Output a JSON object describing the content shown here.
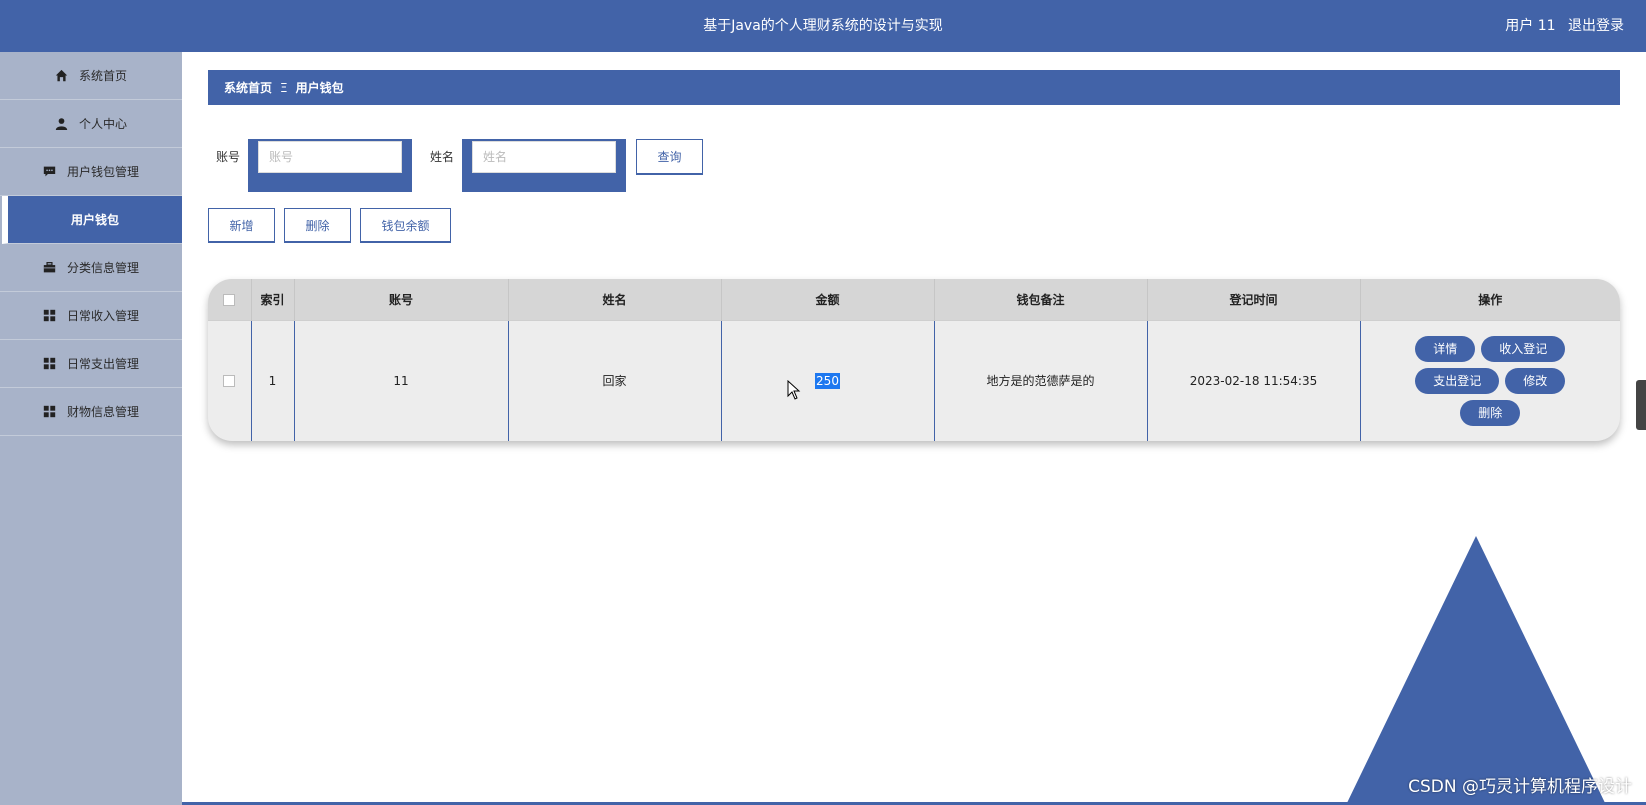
{
  "header": {
    "title": "基于Java的个人理财系统的设计与实现",
    "user_label": "用户 11",
    "logout_label": "退出登录"
  },
  "sidebar": {
    "items": [
      {
        "label": "系统首页",
        "icon": "home-icon"
      },
      {
        "label": "个人中心",
        "icon": "person-icon"
      },
      {
        "label": "用户钱包管理",
        "icon": "chat-icon"
      },
      {
        "label": "用户钱包",
        "icon": "",
        "active": true
      },
      {
        "label": "分类信息管理",
        "icon": "briefcase-icon"
      },
      {
        "label": "日常收入管理",
        "icon": "grid-icon"
      },
      {
        "label": "日常支出管理",
        "icon": "grid-icon"
      },
      {
        "label": "财物信息管理",
        "icon": "grid-icon"
      }
    ]
  },
  "breadcrumb": {
    "home": "系统首页",
    "separator": "Ξ",
    "current": "用户钱包"
  },
  "search": {
    "account_label": "账号",
    "account_placeholder": "账号",
    "account_value": "",
    "name_label": "姓名",
    "name_placeholder": "姓名",
    "name_value": "",
    "query_label": "查询"
  },
  "actions": {
    "add_label": "新增",
    "delete_label": "删除",
    "balance_label": "钱包余额"
  },
  "table": {
    "columns": [
      "索引",
      "账号",
      "姓名",
      "金额",
      "钱包备注",
      "登记时间",
      "操作"
    ],
    "rows": [
      {
        "index": "1",
        "account": "11",
        "name": "回家",
        "amount": "250",
        "note": "地方是的范德萨是的",
        "time": "2023-02-18 11:54:35"
      }
    ],
    "row_actions": {
      "detail": "详情",
      "income": "收入登记",
      "expense": "支出登记",
      "edit": "修改",
      "delete": "删除"
    }
  },
  "colors": {
    "primary": "#4263a8",
    "sidebar_bg": "#a8b3c9",
    "selection": "#1d78f0"
  },
  "watermark": "CSDN @巧灵计算机程序设计"
}
